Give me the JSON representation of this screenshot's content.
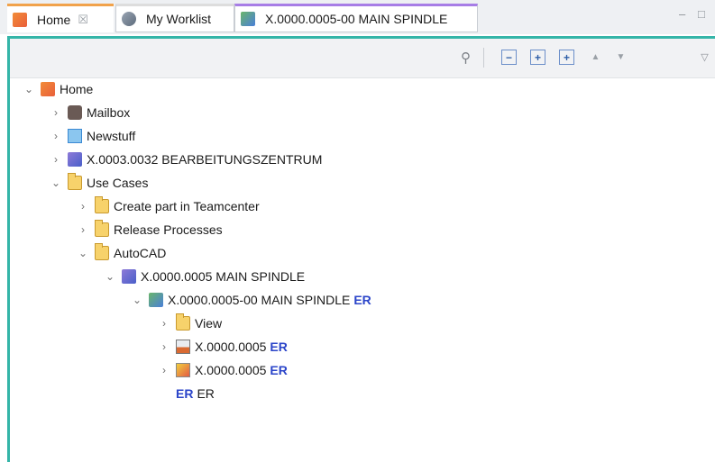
{
  "tabs": [
    {
      "label": "Home",
      "icon": "home-icon",
      "close": "☒"
    },
    {
      "label": "My Worklist",
      "icon": "worklist-icon"
    },
    {
      "label": "X.0000.0005-00 MAIN SPINDLE",
      "icon": "item-revision-icon"
    }
  ],
  "window_controls": {
    "minimize": "–",
    "maximize": "□"
  },
  "toolbar": {
    "search": "⚲",
    "collapse": "−",
    "expand": "+",
    "expand_all": "+",
    "up": "▲",
    "down": "▼",
    "menu": "▽"
  },
  "tree": [
    {
      "label": "Home",
      "expanded": true,
      "icon": "home"
    },
    {
      "label": "Mailbox",
      "icon": "mailbox"
    },
    {
      "label": "Newstuff",
      "icon": "newstuff"
    },
    {
      "label": "X.0003.0032 BEARBEITUNGSZENTRUM",
      "icon": "item"
    },
    {
      "label": "Use Cases",
      "expanded": true,
      "icon": "folder"
    },
    {
      "label": "Create part in Teamcenter",
      "icon": "folder"
    },
    {
      "label": "Release Processes",
      "icon": "folder"
    },
    {
      "label": "AutoCAD",
      "expanded": true,
      "icon": "folder"
    },
    {
      "label": "X.0000.0005 MAIN SPINDLE",
      "expanded": true,
      "icon": "item"
    },
    {
      "label": "X.0000.0005-00 MAIN SPINDLE",
      "badge": "ER",
      "expanded": true,
      "icon": "item-revision"
    },
    {
      "label": "View",
      "icon": "view-folder"
    },
    {
      "label": "X.0000.0005",
      "badge": "ER",
      "icon": "dwg-dataset"
    },
    {
      "label": "X.0000.0005",
      "badge": "ER",
      "icon": "image-dataset"
    },
    {
      "label": "ER",
      "badge_prefix": "ER",
      "icon": "none"
    }
  ],
  "colors": {
    "accent": "#34b5a8",
    "badge": "#2b45c9",
    "home_tab": "#f1a24b",
    "active_tab": "#a77de6"
  }
}
